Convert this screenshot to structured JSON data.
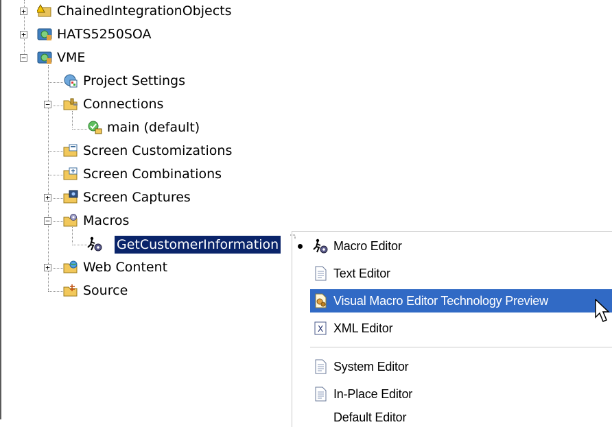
{
  "tree": {
    "items": [
      {
        "label": "ChainedIntegrationObjects",
        "icon": "warning-folder-icon",
        "expander": "+"
      },
      {
        "label": "HATS5250SOA",
        "icon": "hats-project-icon",
        "expander": "+"
      },
      {
        "label": "VME",
        "icon": "hats-project-icon",
        "expander": "−"
      },
      {
        "label": "Project Settings",
        "icon": "settings-icon"
      },
      {
        "label": "Connections",
        "icon": "connections-folder-icon",
        "expander": "−"
      },
      {
        "label": "main (default)",
        "icon": "default-connection-icon"
      },
      {
        "label": "Screen Customizations",
        "icon": "customization-folder-icon"
      },
      {
        "label": "Screen Combinations",
        "icon": "combination-folder-icon"
      },
      {
        "label": "Screen Captures",
        "icon": "capture-folder-icon",
        "expander": "+"
      },
      {
        "label": "Macros",
        "icon": "macros-folder-icon",
        "expander": "−"
      },
      {
        "label": "GetCustomerInformation",
        "icon": "macro-icon",
        "selected": true
      },
      {
        "label": "Web Content",
        "icon": "web-folder-icon",
        "expander": "+"
      },
      {
        "label": "Source",
        "icon": "source-folder-icon"
      }
    ]
  },
  "context_menu": {
    "items": [
      {
        "label": "Macro Editor",
        "icon": "macro-icon",
        "checked": true
      },
      {
        "label": "Text Editor",
        "icon": "text-file-icon"
      },
      {
        "label": "Visual Macro Editor Technology Preview",
        "icon": "visual-macro-icon",
        "highlighted": true
      },
      {
        "label": "XML Editor",
        "icon": "xml-file-icon"
      },
      {
        "label": "System Editor",
        "icon": "text-file-icon"
      },
      {
        "label": "In-Place Editor",
        "icon": "text-file-icon"
      },
      {
        "label": "Default Editor",
        "icon": ""
      }
    ]
  },
  "colors": {
    "selection": "#0a246a",
    "menu_highlight": "#316ac5"
  }
}
